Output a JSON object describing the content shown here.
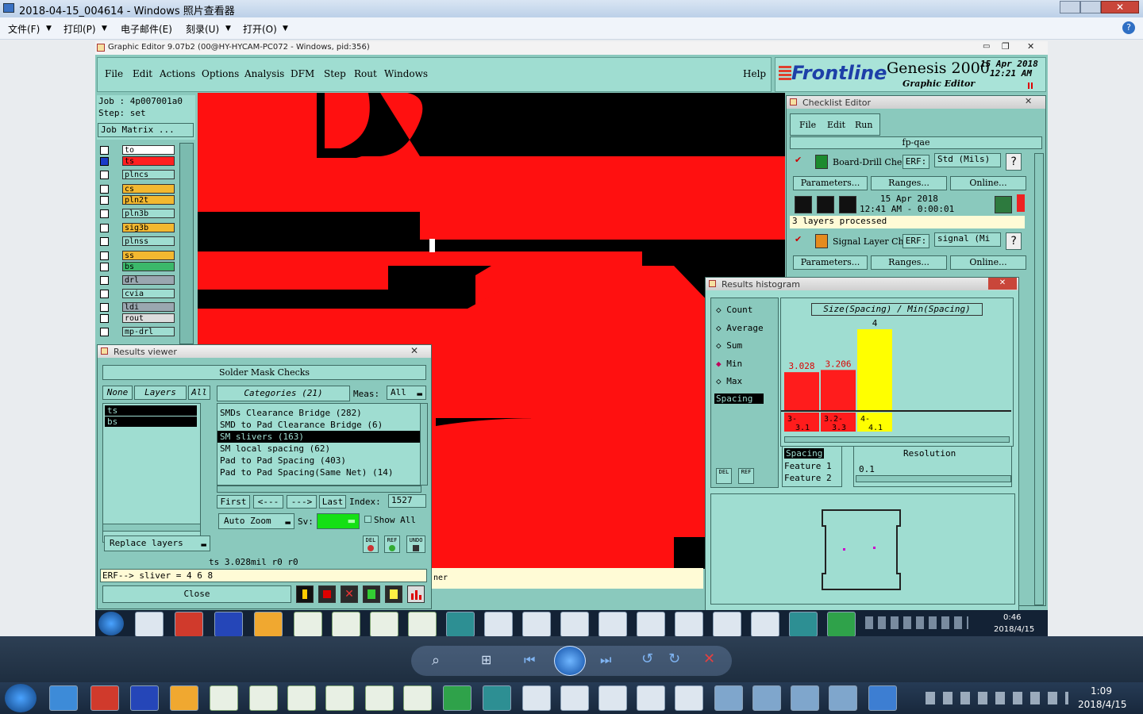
{
  "photo_viewer": {
    "title": "2018-04-15_004614 - Windows 照片查看器",
    "menus": [
      "文件(F)",
      "打印(P)",
      "电子邮件(E)",
      "刻录(U)",
      "打开(O)"
    ]
  },
  "genesis": {
    "window_title": "Graphic Editor 9.07b2 (00@HY-HYCAM-PC072 - Windows, pid:356)",
    "menus": [
      "File",
      "Edit",
      "Actions",
      "Options",
      "Analysis",
      "DFM",
      "Step",
      "Rout",
      "Windows"
    ],
    "help": "Help",
    "brand_logo": "Frontline",
    "brand_product": "Genesis 2000",
    "brand_sub": "Graphic Editor",
    "date": "15 Apr 2018",
    "time": "12:21 AM",
    "job_line": "Job : 4p007001a0",
    "step_line": "Step: set",
    "job_matrix": "Job Matrix ...",
    "layers": [
      {
        "name": "to",
        "color": "#ffffff"
      },
      {
        "name": "ts",
        "color": "#ff2020"
      },
      {
        "name": "plncs",
        "color": "#9fddd1"
      },
      {
        "name": "cs",
        "color": "#f3b830"
      },
      {
        "name": "pln2t",
        "color": "#f3b830"
      },
      {
        "name": "pln3b",
        "color": "#9fddd1"
      },
      {
        "name": "sig3b",
        "color": "#f3b830"
      },
      {
        "name": "plnss",
        "color": "#9fddd1"
      },
      {
        "name": "ss",
        "color": "#f3b830"
      },
      {
        "name": "bs",
        "color": "#3bb86a"
      },
      {
        "name": "drl",
        "color": "#9aa7b0"
      },
      {
        "name": "cvia",
        "color": "#9fddd1"
      },
      {
        "name": "ldi",
        "color": "#9aa7b0"
      },
      {
        "name": "rout",
        "color": "#dddddd"
      },
      {
        "name": "mp-drl",
        "color": "#9fddd1"
      }
    ]
  },
  "results_viewer": {
    "title": "Results viewer",
    "header": "Solder Mask Checks",
    "tabs": {
      "none": "None",
      "layers": "Layers",
      "all": "All"
    },
    "categories_label": "Categories (21)",
    "meas_label": "Meas:",
    "meas_value": "All",
    "layer_list": [
      "ts",
      "bs"
    ],
    "categories": [
      "SMDs Clearance Bridge (282)",
      "SMD to Pad Clearance Bridge (6)",
      "SM slivers (163)",
      "SM local spacing (62)",
      "Pad to Pad Spacing (403)",
      "Pad to Pad Spacing(Same Net) (14)"
    ],
    "selected_category_index": 2,
    "nav": {
      "first": "First",
      "prev": "<---",
      "next": "--->",
      "last": "Last",
      "index_label": "Index:",
      "index_value": "1527"
    },
    "auto_zoom": "Auto Zoom",
    "sv_label": "Sv:",
    "show_all": "Show All",
    "replace_layers": "Replace layers",
    "status": "ts 3.028mil  r0  r0",
    "erf": "ERF--> sliver = 4 6 8",
    "close": "Close",
    "icons_text": [
      "DEL",
      "REF",
      "UNDO"
    ],
    "behind_text": "ner"
  },
  "checklist": {
    "title": "Checklist Editor",
    "menus": [
      "File",
      "Edit",
      "Run"
    ],
    "name": "fp-qae",
    "rows": [
      {
        "name": "Board-Drill Che",
        "erf_label": "ERF:",
        "erf_value": "Std (Mils)",
        "buttons": [
          "Parameters...",
          "Ranges...",
          "Online..."
        ]
      },
      {
        "name": "Signal Layer Ch",
        "erf_label": "ERF:",
        "erf_value": "signal (Mi",
        "buttons": [
          "Parameters...",
          "Ranges...",
          "Online..."
        ]
      }
    ],
    "run_date": "15 Apr 2018",
    "run_time": "12:41 AM - 0:00:01",
    "status": "3 layers processed",
    "help": "?"
  },
  "histogram": {
    "title": "Results histogram",
    "options": [
      {
        "label": "Count",
        "selected": false
      },
      {
        "label": "Average",
        "selected": false
      },
      {
        "label": "Sum",
        "selected": false
      },
      {
        "label": "Min",
        "selected": true
      },
      {
        "label": "Max",
        "selected": false
      }
    ],
    "list": [
      "Spacing"
    ],
    "chart_title": "Size(Spacing) / Min(Spacing)",
    "legend": [
      "Spacing",
      "Feature 1",
      "Feature 2"
    ],
    "resolution_label": "Resolution",
    "resolution_value": "0.1",
    "del": "DEL",
    "ref": "REF"
  },
  "chart_data": {
    "type": "bar",
    "title": "Size(Spacing) / Min(Spacing)",
    "categories": [
      "3-3.1",
      "3.2-3.3",
      "4-4.1"
    ],
    "labels": [
      "3.028",
      "3.206",
      "4"
    ],
    "values": [
      3.028,
      3.206,
      4
    ],
    "colors": [
      "#ff1c1c",
      "#ff1c1c",
      "#ffff00"
    ],
    "ylim": [
      0,
      4
    ]
  },
  "taskbar_inner": {
    "time": "0:46",
    "date": "2018/4/15"
  },
  "taskbar_outer": {
    "time": "1:09",
    "date": "2018/4/15"
  }
}
